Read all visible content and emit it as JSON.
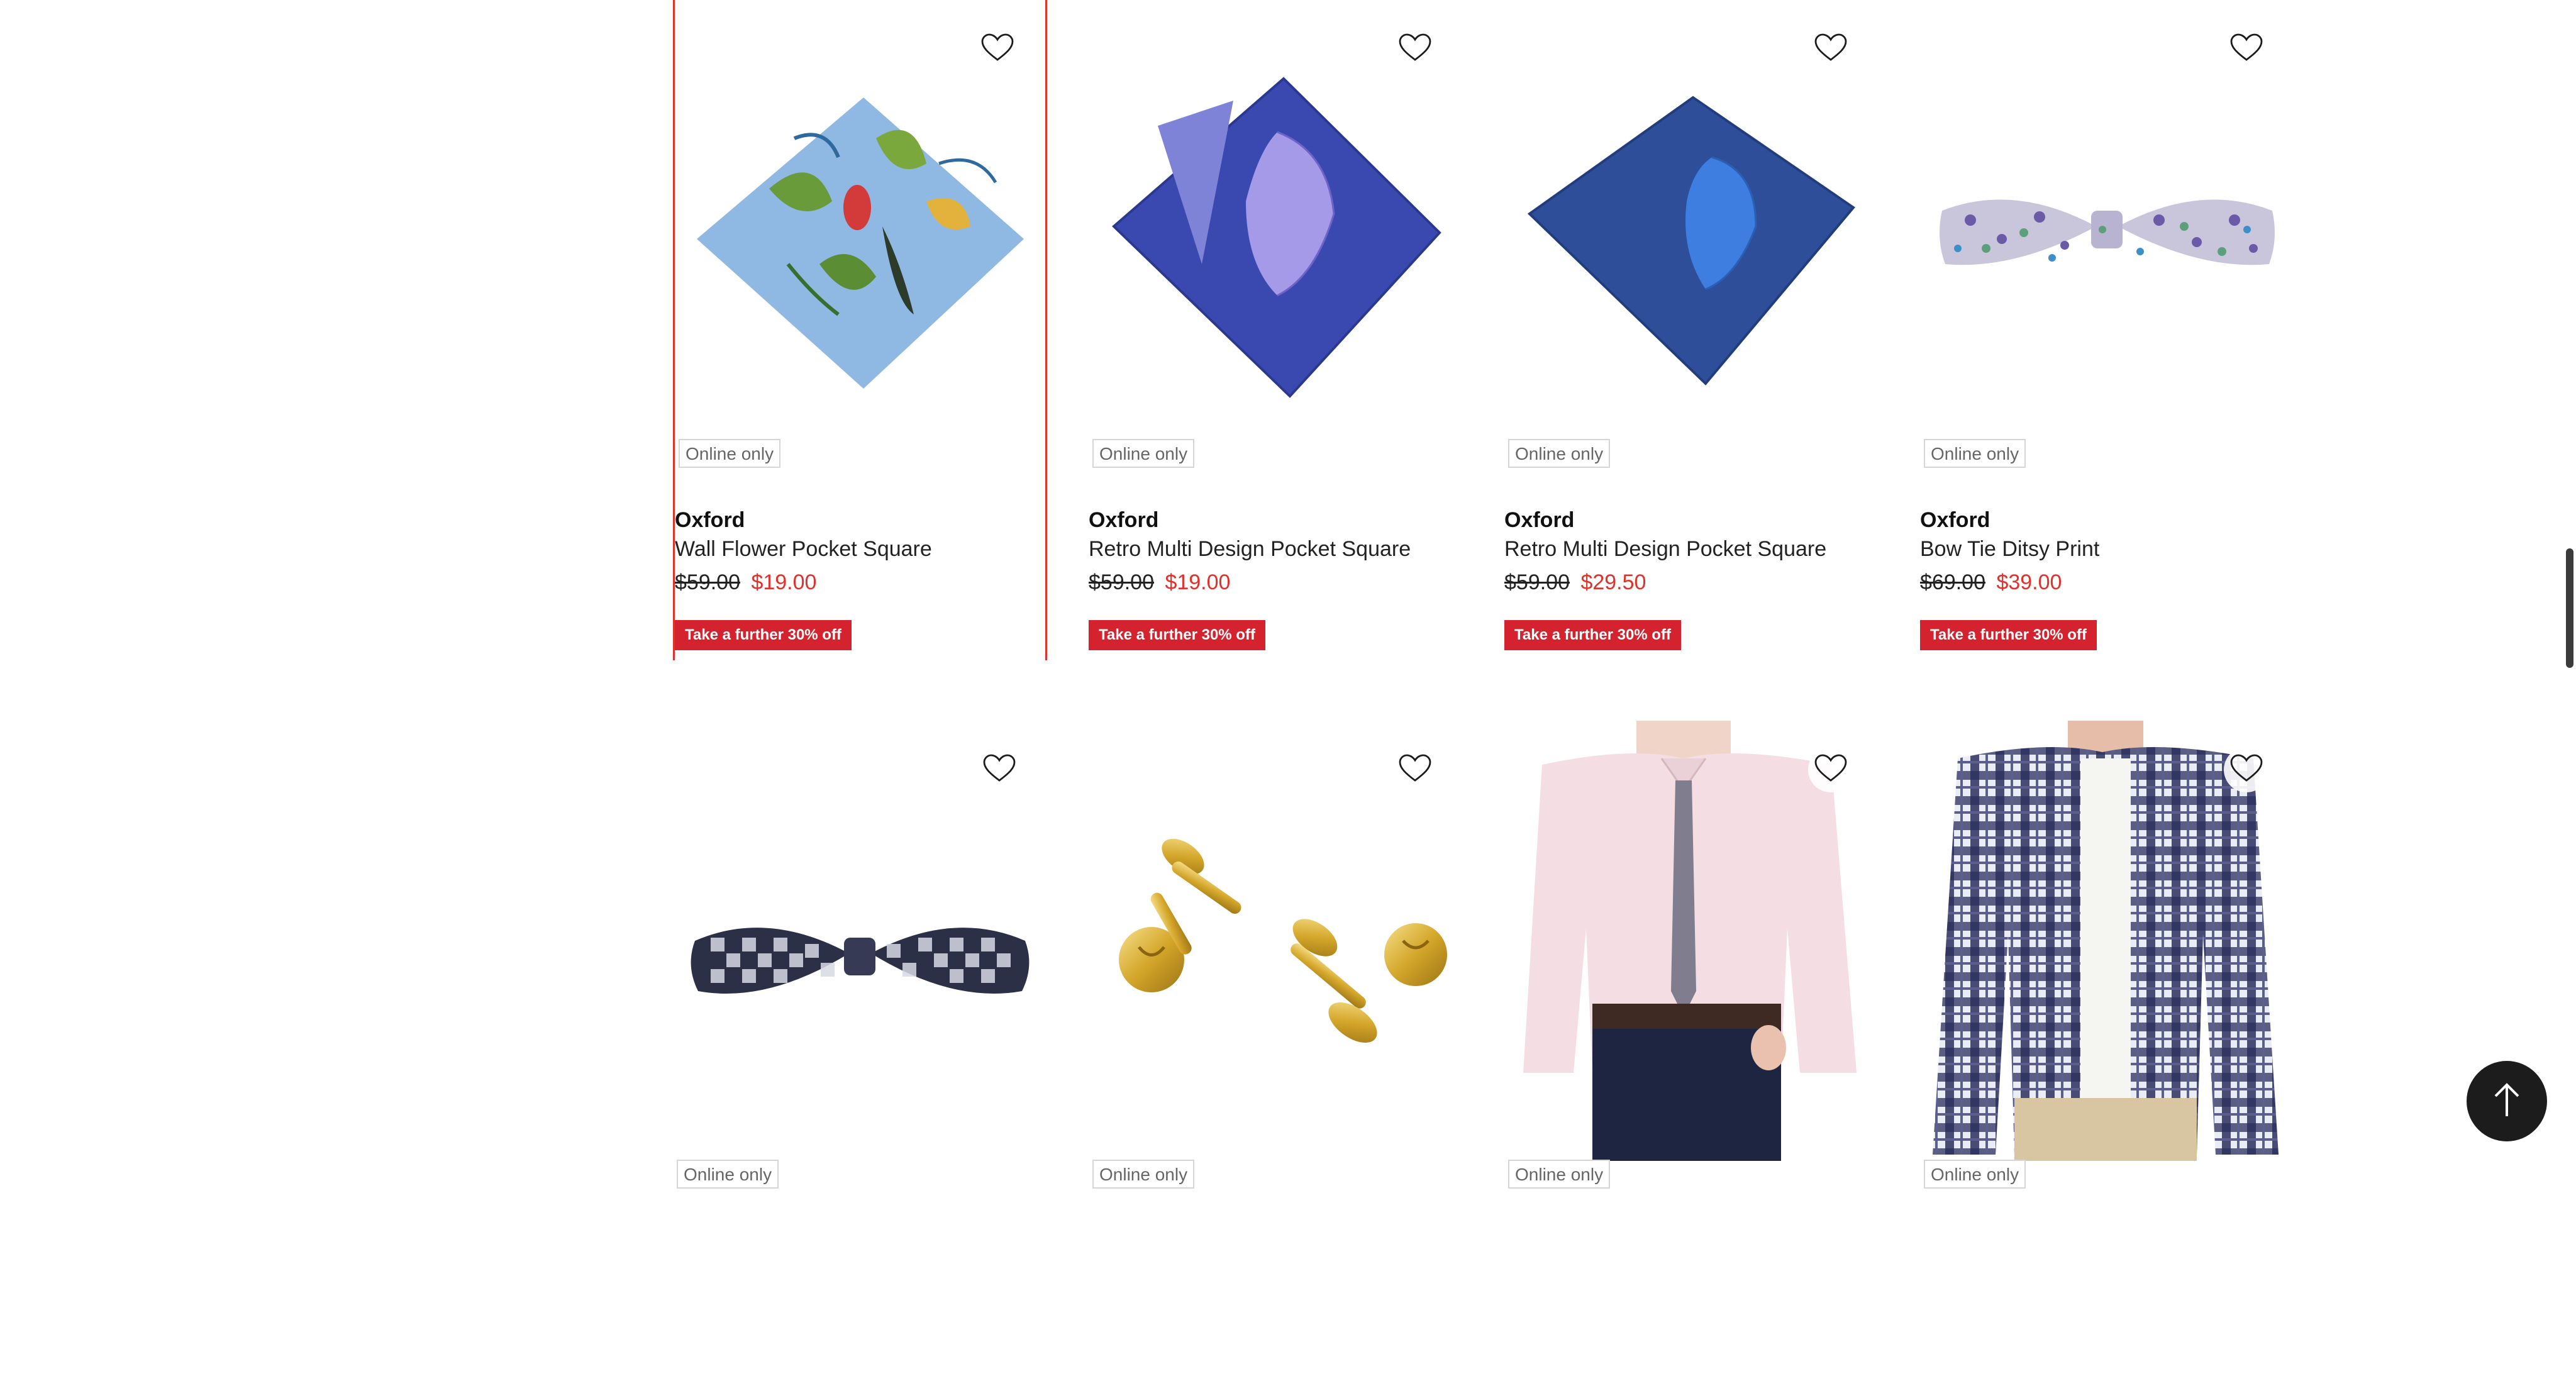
{
  "products": [
    {
      "badge": "Online only",
      "brand": "Oxford",
      "name": "Wall Flower Pocket Square",
      "was": "$59.00",
      "now": "$19.00",
      "promo": "Take a further 30% off"
    },
    {
      "badge": "Online only",
      "brand": "Oxford",
      "name": "Retro Multi Design Pocket Square",
      "was": "$59.00",
      "now": "$19.00",
      "promo": "Take a further 30% off"
    },
    {
      "badge": "Online only",
      "brand": "Oxford",
      "name": "Retro Multi Design Pocket Square",
      "was": "$59.00",
      "now": "$29.50",
      "promo": "Take a further 30% off"
    },
    {
      "badge": "Online only",
      "brand": "Oxford",
      "name": "Bow Tie Ditsy Print",
      "was": "$69.00",
      "now": "$39.00",
      "promo": "Take a further 30% off"
    },
    {
      "badge": "Online only"
    },
    {
      "badge": "Online only"
    },
    {
      "badge": "Online only"
    },
    {
      "badge": "Online only"
    }
  ],
  "icons": {
    "wishlist": "heart-outline-icon",
    "back_to_top": "arrow-up-icon"
  },
  "colors": {
    "sale_price": "#e0312c",
    "promo_bg": "#d4232e",
    "focus_border": "#e0312c"
  }
}
